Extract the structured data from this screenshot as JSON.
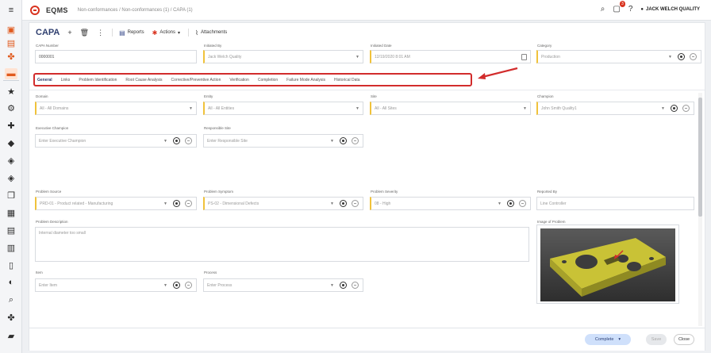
{
  "header": {
    "app_name": "EQMS",
    "breadcrumb": "Non-conformances / Non-conformances (1) / CAPA (1)",
    "notification_count": "3",
    "user_name": "JACK WELCH QUALITY"
  },
  "toolbar": {
    "title": "CAPA",
    "add": "+",
    "delete": "🗑",
    "more": "⋮",
    "reports": "Reports",
    "actions": "Actions",
    "attachments": "Attachments"
  },
  "top_fields": {
    "capa_number": {
      "label": "CAPA Number",
      "value": "0000001"
    },
    "initiated_by": {
      "label": "Initiated By",
      "value": "Jack Welch Quality"
    },
    "initiated_date": {
      "label": "Initiated Date",
      "value": "12/19/2020 8:01 AM"
    },
    "category": {
      "label": "Category",
      "value": "Production"
    }
  },
  "tabs": [
    "General",
    "Links",
    "Problem Identification",
    "Root Cause Analysis",
    "Corrective/Preventive Action",
    "Verification",
    "Completion",
    "Failure Mode Analysis",
    "Historical Data"
  ],
  "form": {
    "domain": {
      "label": "Domain",
      "value": "All - All Domains"
    },
    "entity": {
      "label": "Entity",
      "value": "All - All Entities"
    },
    "site": {
      "label": "Site",
      "value": "All - All Sites"
    },
    "champion": {
      "label": "Champion",
      "value": "John Smith Quality1"
    },
    "executive_champion": {
      "label": "Executive Champion",
      "placeholder": "Enter Executive Champion"
    },
    "responsible_site": {
      "label": "Responsible Site",
      "placeholder": "Enter Responsible Site"
    },
    "problem_source": {
      "label": "Problem Source",
      "value": "PRD-01 - Product related - Manufacturing"
    },
    "problem_symptom": {
      "label": "Problem Symptom",
      "value": "PS-02 - Dimensional Defects"
    },
    "problem_severity": {
      "label": "Problem Severity",
      "value": "08 - High"
    },
    "reported_by": {
      "label": "Reported By",
      "placeholder": "Line Controller"
    },
    "problem_description": {
      "label": "Problem Description",
      "value": "Internal diameter too small"
    },
    "image_of_problem": {
      "label": "Image of Problem"
    },
    "item": {
      "label": "Item",
      "placeholder": "Enter Item"
    },
    "process": {
      "label": "Process",
      "placeholder": "Enter Process"
    }
  },
  "footer": {
    "complete": "Complete",
    "save": "Save",
    "close": "Close"
  },
  "colors": {
    "accent": "#2f3f6f",
    "required": "#f0c23b",
    "highlight": "#d22c2c"
  }
}
